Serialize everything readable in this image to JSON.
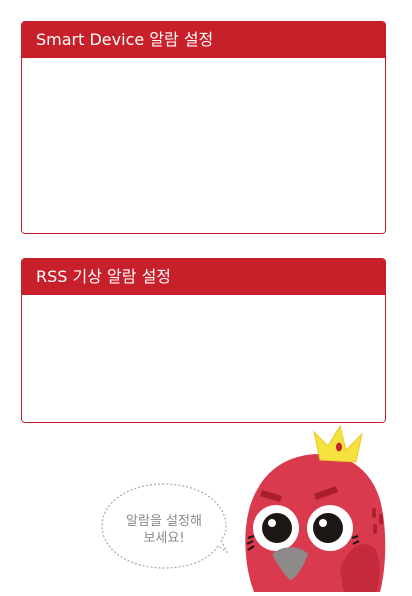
{
  "panels": {
    "smart_device": {
      "title": "Smart Device 알람 설정"
    },
    "rss": {
      "title": "RSS 기상 알람 설정"
    }
  },
  "mascot": {
    "speech": "알람을 설정해\n보세요!",
    "icon": "bird-mascot-with-crown"
  },
  "colors": {
    "header_red": "#c8202b",
    "mascot_red": "#d93a4e",
    "crown_yellow": "#f6e23c"
  }
}
